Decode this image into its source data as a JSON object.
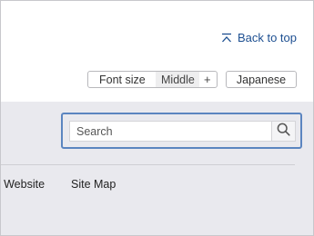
{
  "header": {
    "back_to_top_label": "Back to top",
    "font_size": {
      "label": "Font size",
      "value": "Middle",
      "increase_label": "+"
    },
    "language_button_label": "Japanese"
  },
  "search": {
    "placeholder": "Search"
  },
  "footer": {
    "links": [
      {
        "label": "This Website"
      },
      {
        "label": "Site Map"
      }
    ]
  },
  "colors": {
    "link": "#1d4f91",
    "focus_border": "#5b85c0",
    "panel_background": "#e9e9ee"
  },
  "icons": {
    "back_to_top": "arrow-up-bar-icon",
    "search": "magnifier-icon"
  }
}
